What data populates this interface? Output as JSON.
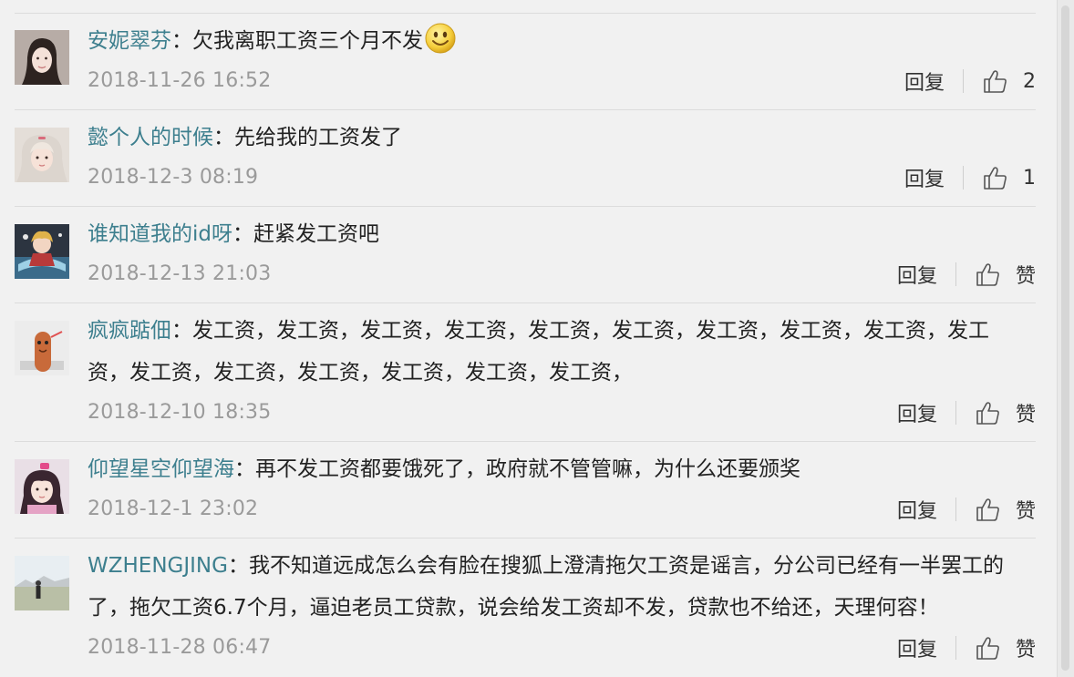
{
  "actions": {
    "reply_label": "回复",
    "like_label": "赞"
  },
  "colors": {
    "name": "#3d7f8e",
    "text": "#222222",
    "time": "#9a9a9a",
    "background": "#f1f1f1"
  },
  "comments": [
    {
      "author": "安妮翠芬",
      "separator": "：",
      "content": "欠我离职工资三个月不发",
      "time": "2018-11-26 16:52",
      "likes": "2",
      "emoji": "smiley"
    },
    {
      "author": "懿个人的时候",
      "separator": "：",
      "content": "先给我的工资发了",
      "time": "2018-12-3 08:19",
      "likes": "1"
    },
    {
      "author": "谁知道我的id呀",
      "separator": "：",
      "content": "赶紧发工资吧",
      "time": "2018-12-13 21:03",
      "likes": ""
    },
    {
      "author": "疯疯踮佃",
      "separator": "：",
      "content": "发工资，发工资，发工资，发工资，发工资，发工资，发工资，发工资，发工资，发工资，发工资，发工资，发工资，发工资，发工资，发工资，",
      "time": "2018-12-10 18:35",
      "likes": ""
    },
    {
      "author": "仰望星空仰望海",
      "separator": "：",
      "content": "再不发工资都要饿死了，政府就不管管嘛，为什么还要颁奖",
      "time": "2018-12-1 23:02",
      "likes": ""
    },
    {
      "author": "WZHENGJING",
      "separator": "：",
      "content": "我不知道远成怎么会有脸在搜狐上澄清拖欠工资是谣言，分公司已经有一半罢工的了，拖欠工资6.7个月，逼迫老员工贷款，说会给发工资却不发，贷款也不给还，天理何容！",
      "time": "2018-11-28 06:47",
      "likes": ""
    }
  ]
}
